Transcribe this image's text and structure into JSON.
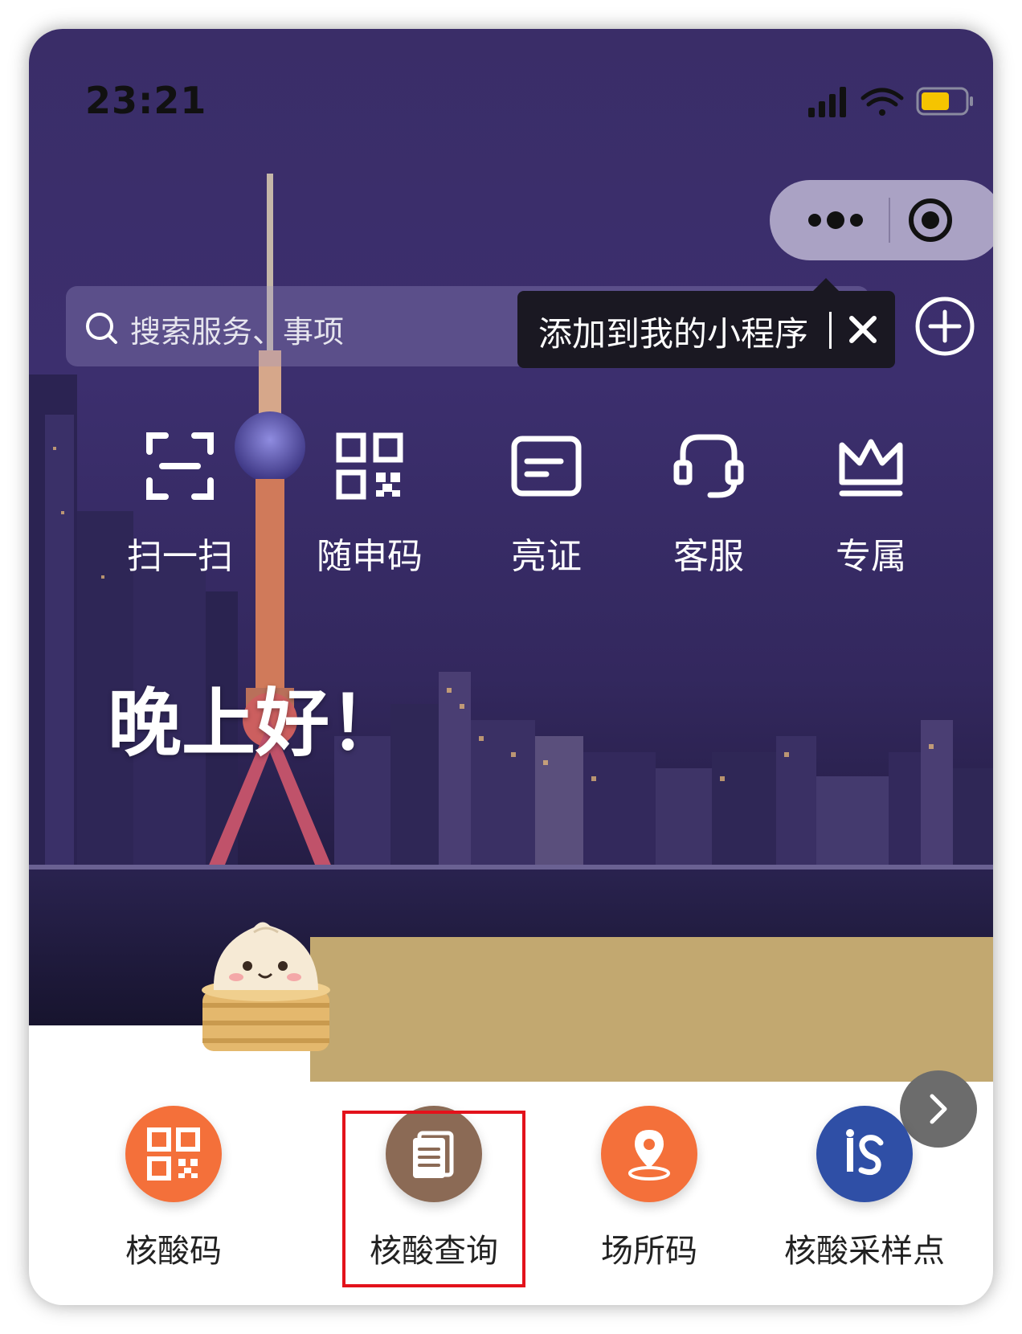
{
  "status_bar": {
    "time": "23:21"
  },
  "search": {
    "placeholder": "搜索服务、事项"
  },
  "tooltip": {
    "text": "添加到我的小程序"
  },
  "quick_actions": [
    {
      "label": "扫一扫",
      "icon": "scan-icon"
    },
    {
      "label": "随申码",
      "icon": "qr-code-icon"
    },
    {
      "label": "亮证",
      "icon": "id-card-icon"
    },
    {
      "label": "客服",
      "icon": "headset-icon"
    },
    {
      "label": "专属",
      "icon": "crown-icon"
    }
  ],
  "greeting": "晚上好！",
  "services": [
    {
      "label": "核酸码",
      "icon": "qr-code-icon",
      "color": "#f4703a"
    },
    {
      "label": "核酸查询",
      "icon": "document-icon",
      "color": "#8b6a55"
    },
    {
      "label": "场所码",
      "icon": "location-pin-icon",
      "color": "#f4703a"
    },
    {
      "label": "核酸采样点",
      "icon": "is-logo-icon",
      "color": "#2f4fa6"
    }
  ],
  "colors": {
    "hero_bg": "#3c2f6e",
    "banner_gold": "#c2a870",
    "highlight_red": "#e3121b"
  }
}
